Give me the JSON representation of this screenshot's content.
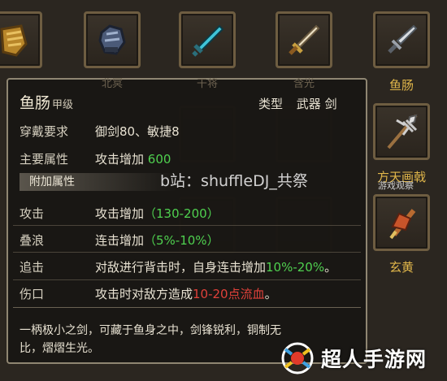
{
  "slots": [
    {
      "name": "slot-gauntlet",
      "label": "",
      "dim": false
    },
    {
      "name": "slot-gloves",
      "label": "北冥",
      "dim": true
    },
    {
      "name": "slot-teal-sword",
      "label": "干将",
      "dim": true
    },
    {
      "name": "slot-dagger",
      "label": "含光",
      "dim": true
    },
    {
      "name": "slot-yuchang",
      "label": "鱼肠",
      "dim": false
    },
    {
      "name": "slot-fangtian",
      "label": "方天画戟",
      "dim": false
    },
    {
      "name": "slot-xuanhuang",
      "label": "玄黄",
      "dim": false
    }
  ],
  "colors": {
    "gold": "#e0b64a",
    "green": "#4fd04f",
    "red": "#e0413a"
  },
  "tooltip": {
    "name": "鱼肠",
    "grade": "甲级",
    "type_label": "类型",
    "type_value": "武器 剑",
    "req_label": "穿戴要求",
    "req_value": "御剑80、敏捷8",
    "main_label": "主要属性",
    "main_prefix": "攻击增加",
    "main_value": "600",
    "extra_section": "附加属性",
    "attrs": [
      {
        "label": "攻击",
        "prefix": "攻击增加",
        "value": "（130-200）",
        "suffix": ""
      },
      {
        "label": "叠浪",
        "prefix": "连击增加",
        "value": "（5%-10%）",
        "suffix": ""
      }
    ],
    "zhuiji_label": "追击",
    "zhuiji_prefix": "对敌进行背击时，自身连击增加",
    "zhuiji_value": "10%-20%",
    "zhuiji_suffix": "。",
    "shangkou_label": "伤口",
    "shangkou_prefix": "攻击时对敌方造成",
    "shangkou_value": "10-20点流血",
    "shangkou_suffix": "。",
    "desc_line1": "一柄极小之剑，可藏于鱼身之中，剑锋锐利，铜制无",
    "desc_line2": "比，熠熠生光。"
  },
  "watermark": "b站：shuffleDJ_共祭",
  "watermark_small": "游戏观察",
  "logo_text": "超人手游网"
}
